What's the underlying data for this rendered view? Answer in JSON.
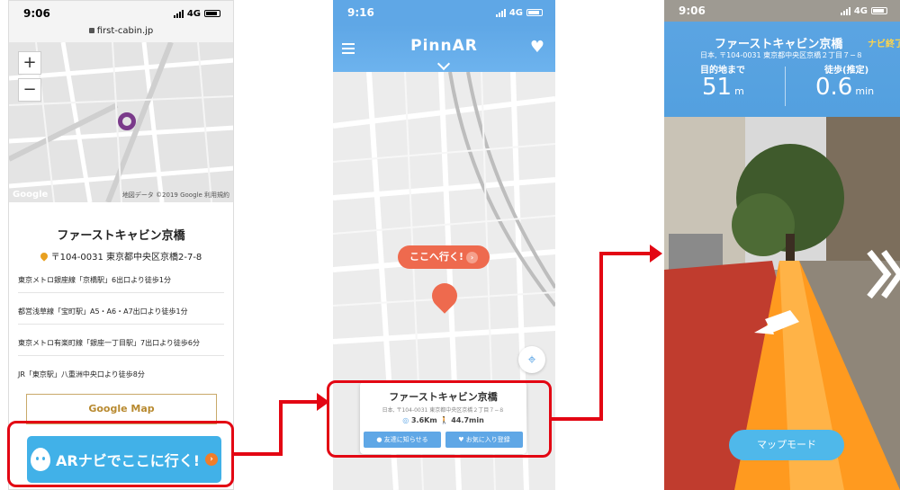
{
  "phone1": {
    "time": "9:06",
    "network": "4G",
    "url": "first-cabin.jp",
    "zoom_in": "+",
    "zoom_out": "−",
    "map_credit": "地図データ ©2019 Google   利用規約",
    "google_logo": "Google",
    "hotel_name": "ファーストキャビン京橋",
    "address": "〒104-0031 東京都中央区京橋2-7-8",
    "access": [
      "東京メトロ銀座線「京橋駅」6出口より徒歩1分",
      "都営浅草線「宝町駅」A5・A6・A7出口より徒歩1分",
      "東京メトロ有楽町線「銀座一丁目駅」7出口より徒歩6分",
      "JR「東京駅」八重洲中央口より徒歩8分"
    ],
    "google_map_button": "Google Map",
    "ar_button": "ARナビでここに行く!"
  },
  "phone2": {
    "time": "9:16",
    "network": "4G",
    "app_title": "PinnAR",
    "goto_label": "ここへ行く!",
    "card_name": "ファーストキャビン京橋",
    "card_address": "日本, 〒104-0031 東京都中央区京橋２丁目７−８",
    "distance": "3.6Km",
    "walk_time": "44.7min",
    "share_button": "友達に知らせる",
    "favorite_button": "お気に入り登録"
  },
  "phone3": {
    "time": "9:06",
    "network": "4G",
    "title": "ファーストキャビン京橋",
    "end_nav": "ナビ終了",
    "address": "日本, 〒104-0031 東京都中央区京橋２丁目７−８",
    "dest_label": "目的地まで",
    "dest_value": "51",
    "dest_unit": "m",
    "walk_label": "徒歩(推定)",
    "walk_value": "0.6",
    "walk_unit": "min",
    "map_mode_button": "マップモード"
  },
  "colors": {
    "highlight": "#e30613",
    "app_blue": "#5fa7e6",
    "ar_button_blue": "#41b1e8",
    "pin_coral": "#ee6a4e",
    "ar_path_orange": "#ff9a1f"
  }
}
